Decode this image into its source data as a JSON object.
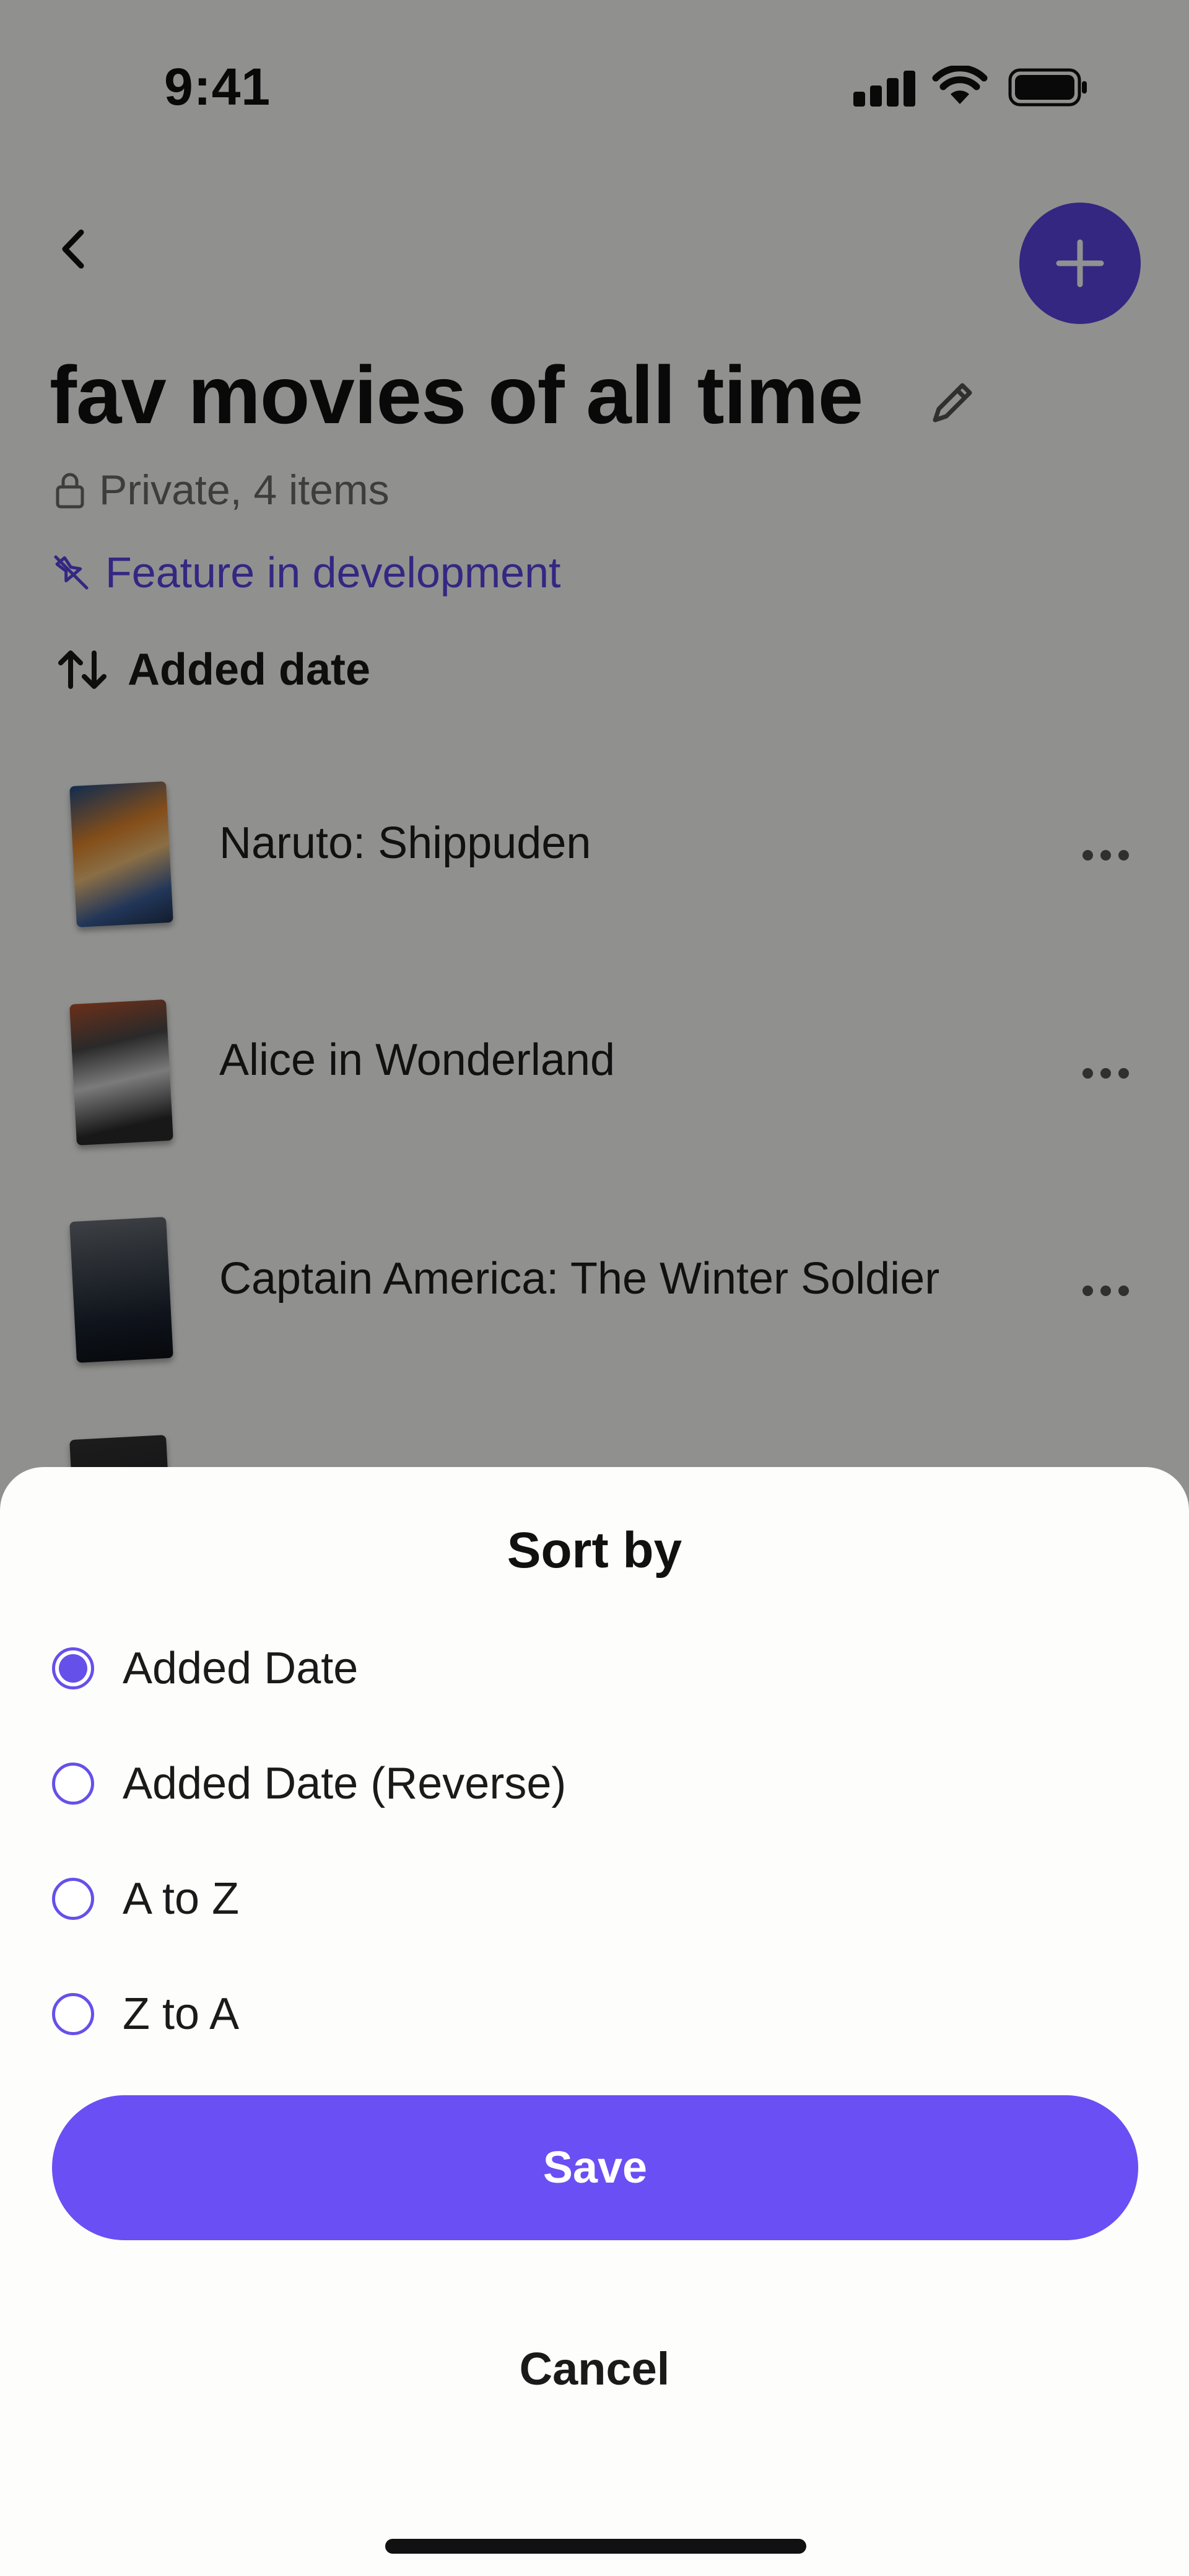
{
  "status_bar": {
    "time": "9:41"
  },
  "header": {
    "title": "fav movies of all time",
    "meta": "Private, 4 items",
    "dev_notice": "Feature in development",
    "sort_label": "Added date"
  },
  "items": [
    {
      "title": "Naruto: Shippuden"
    },
    {
      "title": "Alice in Wonderland"
    },
    {
      "title": "Captain America: The Winter Soldier"
    }
  ],
  "sheet": {
    "title": "Sort by",
    "options": [
      {
        "label": "Added Date",
        "selected": true
      },
      {
        "label": "Added Date (Reverse)",
        "selected": false
      },
      {
        "label": "A to Z",
        "selected": false
      },
      {
        "label": "Z to A",
        "selected": false
      }
    ],
    "save_label": "Save",
    "cancel_label": "Cancel"
  },
  "colors": {
    "accent": "#5b46e4",
    "button": "#6a4ff4",
    "overlay": "rgba(0,0,0,0.43)"
  }
}
